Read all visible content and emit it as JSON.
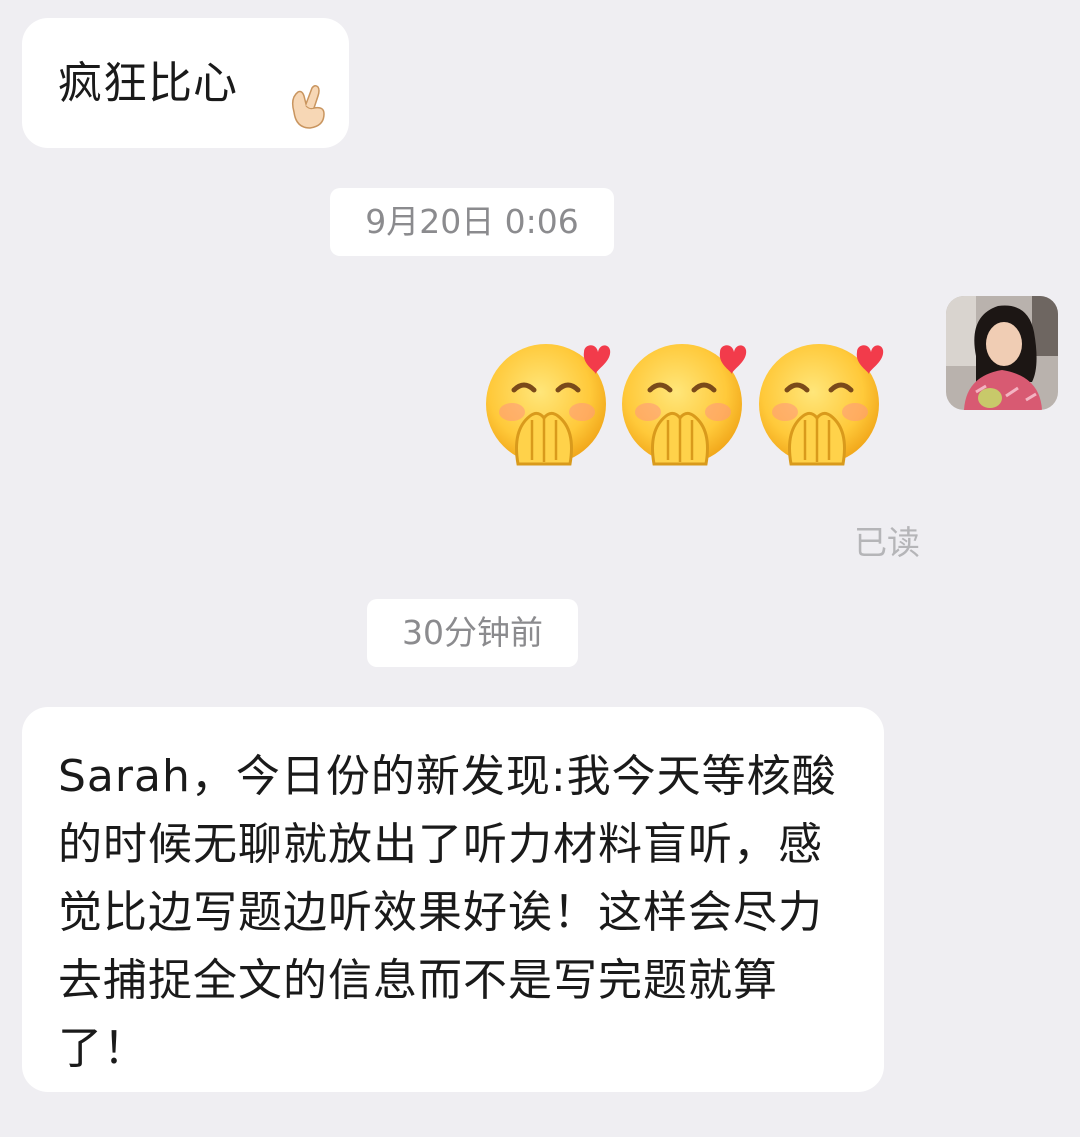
{
  "messages": [
    {
      "text": "疯狂比心",
      "emoji": "finger-heart-icon"
    },
    {
      "timestamp": "9月20日 0:06"
    },
    {
      "emojis": [
        "blushing-heart-hands-icon",
        "blushing-heart-hands-icon",
        "blushing-heart-hands-icon"
      ],
      "read_status": "已读"
    },
    {
      "timestamp": "30分钟前"
    },
    {
      "text": "Sarah，今日份的新发现:我今天等核酸的时候无聊就放出了听力材料盲听，感觉比边写题边听效果好诶！这样会尽力去捕捉全文的信息而不是写完题就算了！"
    }
  ],
  "colors": {
    "background": "#efeef2",
    "bubble": "#ffffff",
    "timestamp_text": "#8b8b8e",
    "read_text": "#b5b5b8"
  }
}
